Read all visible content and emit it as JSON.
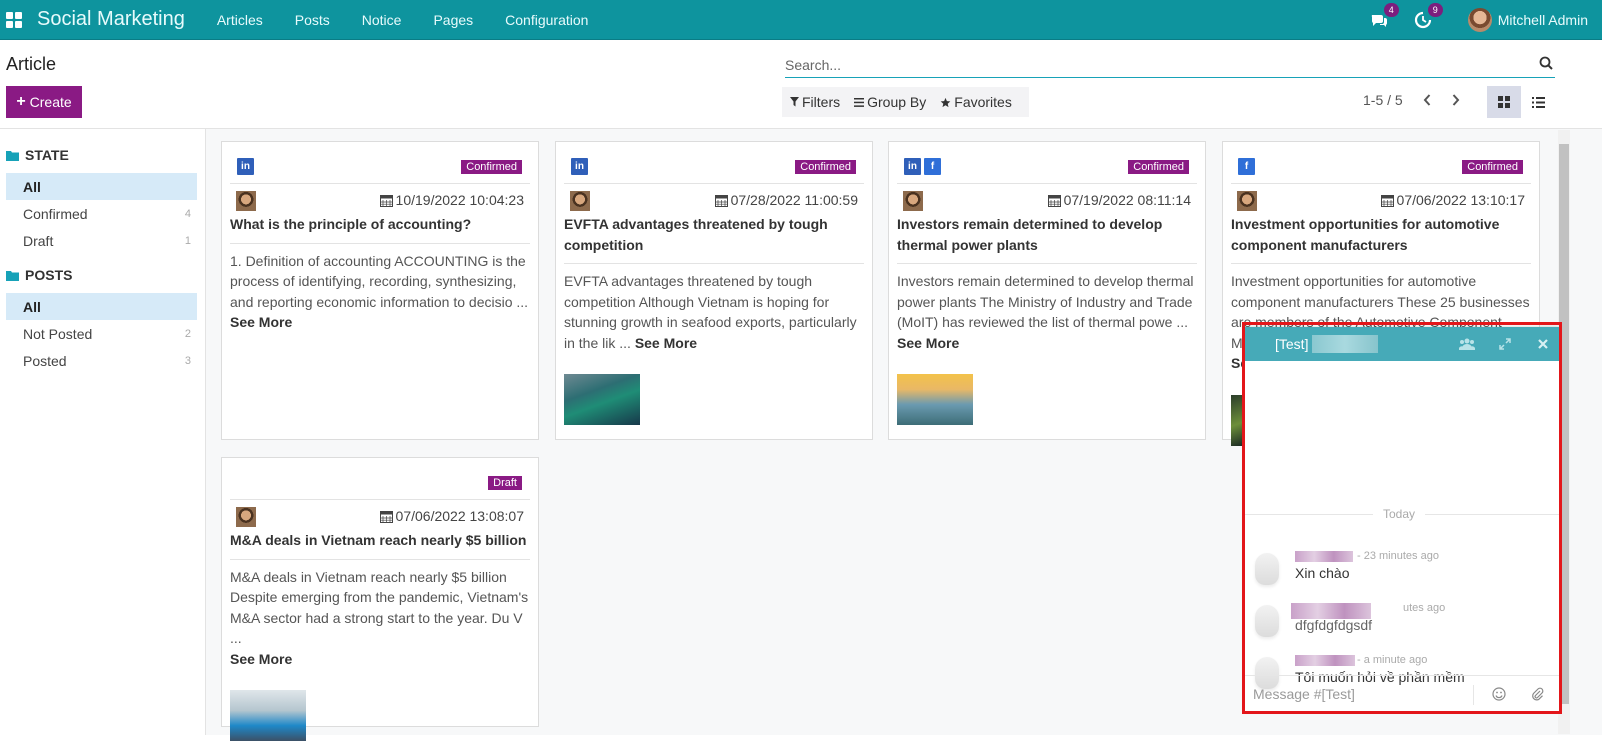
{
  "navbar": {
    "app_name": "Social Marketing",
    "menu": [
      "Articles",
      "Posts",
      "Notice",
      "Pages",
      "Configuration"
    ],
    "messages_count": "4",
    "activities_count": "9",
    "user_name": "Mitchell Admin"
  },
  "control_panel": {
    "title": "Article",
    "create_label": "Create",
    "search_placeholder": "Search...",
    "filters_label": "Filters",
    "group_by_label": "Group By",
    "favorites_label": "Favorites",
    "pager": "1-5 / 5"
  },
  "sidebar": {
    "groups": [
      {
        "title": "STATE",
        "items": [
          {
            "label": "All",
            "count": "",
            "active": true
          },
          {
            "label": "Confirmed",
            "count": "4",
            "active": false
          },
          {
            "label": "Draft",
            "count": "1",
            "active": false
          }
        ]
      },
      {
        "title": "POSTS",
        "items": [
          {
            "label": "All",
            "count": "",
            "active": true
          },
          {
            "label": "Not Posted",
            "count": "2",
            "active": false
          },
          {
            "label": "Posted",
            "count": "3",
            "active": false
          }
        ]
      }
    ]
  },
  "cards": [
    {
      "socials": [
        "linkedin"
      ],
      "state": "Confirmed",
      "date": "10/19/2022 10:04:23",
      "title": "What is the principle of accounting?",
      "excerpt": "1. Definition of accounting ACCOUNTING is the process of identifying, recording, synthesizing, and reporting economic information to decisio ...",
      "see_more": "See More",
      "image": null
    },
    {
      "socials": [
        "linkedin"
      ],
      "state": "Confirmed",
      "date": "07/28/2022 11:00:59",
      "title": "EVFTA advantages threatened by tough competition",
      "excerpt": "EVFTA advantages threatened by tough competition Although Vietnam is hoping for stunning growth in seafood exports, particularly in the lik ...",
      "see_more": "See More",
      "image": "fishing-boat"
    },
    {
      "socials": [
        "linkedin",
        "facebook"
      ],
      "state": "Confirmed",
      "date": "07/19/2022 08:11:14",
      "title": "Investors remain determined to develop thermal power plants",
      "excerpt": "Investors remain determined to develop thermal power plants The Ministry of Industry and Trade (MoIT) has reviewed the list of thermal powe ...",
      "see_more": "See More",
      "image": "power-plant"
    },
    {
      "socials": [
        "facebook"
      ],
      "state": "Confirmed",
      "date": "07/06/2022 13:10:17",
      "title": "Investment opportunities for automotive component manufacturers",
      "excerpt": "Investment opportunities for automotive component manufacturers These 25 businesses are members of the Automotive Component Manufacturers ...",
      "see_more": "See More",
      "image": "circuit"
    },
    {
      "socials": [],
      "state": "Draft",
      "date": "07/06/2022 13:08:07",
      "title": "M&A deals in Vietnam reach nearly $5 billion",
      "excerpt": "M&A deals in Vietnam reach nearly $5 billion Despite emerging from the pandemic, Vietnam's M&A sector had a strong start to the year. Du V ...",
      "see_more": "See More",
      "image": "meeting-room"
    }
  ],
  "chat": {
    "title_prefix": "[Test]",
    "day_label": "Today",
    "messages": [
      {
        "time": "- 23 minutes ago",
        "text": "Xin chào"
      },
      {
        "time": "utes ago",
        "text": "dfgfdgfdgsdf"
      },
      {
        "time": "- a minute ago",
        "text": "Tôi muốn hỏi về phần mềm"
      }
    ],
    "composer_placeholder": "Message #[Test]",
    "icons": {
      "members": "users-icon",
      "expand": "expand-icon",
      "close": "close-icon",
      "emoji": "emoji-icon",
      "attach": "paperclip-icon"
    }
  },
  "colors": {
    "navbar": "#0e949e",
    "primary": "#8a1a84",
    "chat_header": "#46aab8",
    "highlight_outline": "#e3161a",
    "sidebar_active": "#d6eaf8"
  }
}
